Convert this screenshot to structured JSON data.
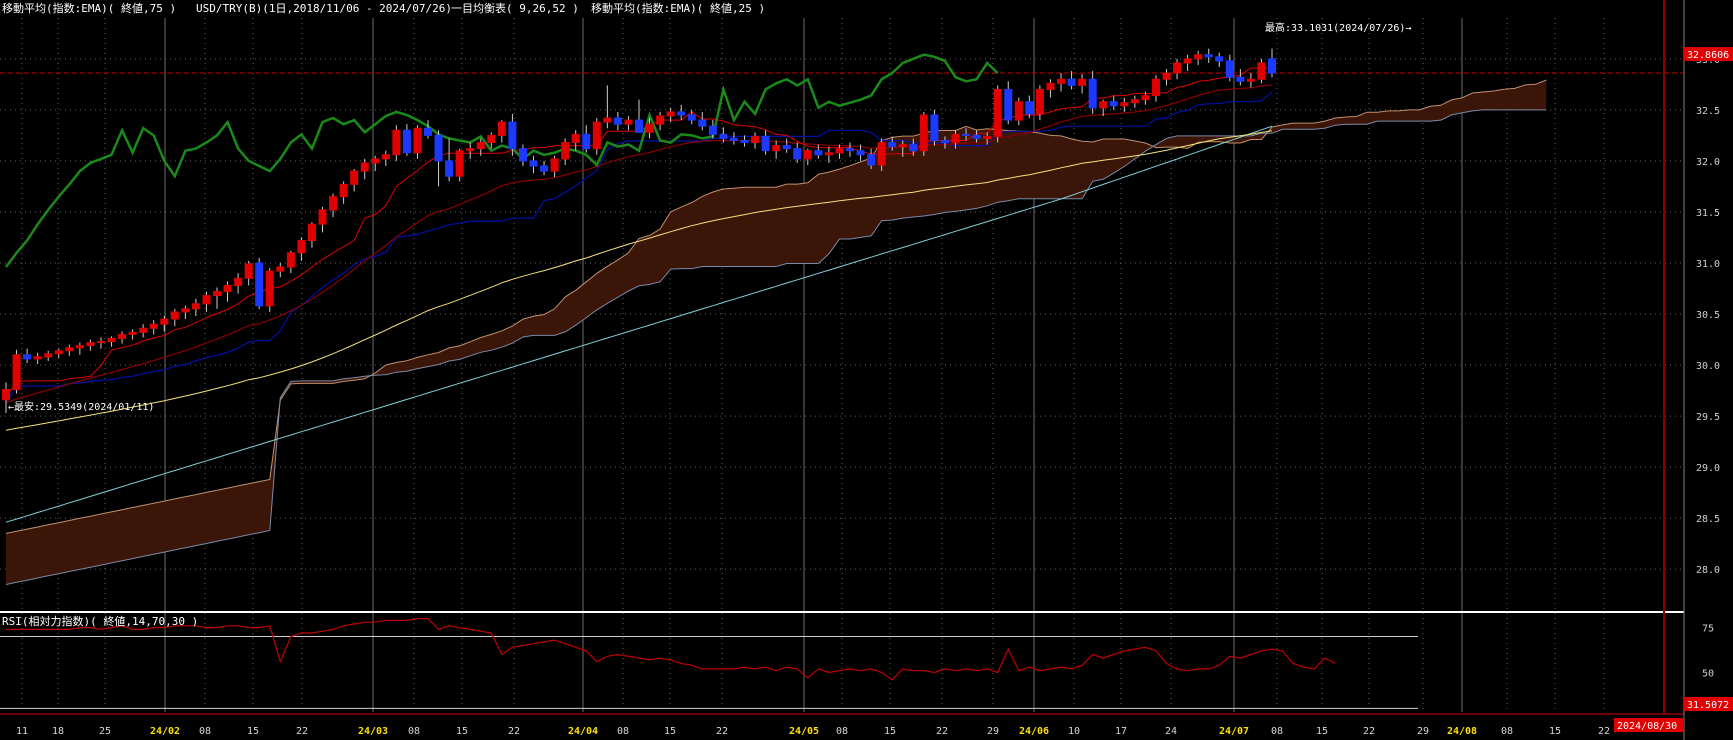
{
  "header": {
    "ema75_label": "移動平均(指数:EMA)( 終値,75 )",
    "symbol_label": "USD/TRY(B)(1日,2018/11/06 - 2024/07/26)",
    "ichimoku_label": "一目均衡表( 9,26,52 )",
    "ema25_label": "移動平均(指数:EMA)( 終値,25 )"
  },
  "annotations": {
    "high": "最高:33.1031(2024/07/26)→",
    "low": "←最安:29.5349(2024/01/11)"
  },
  "price_tag": "32.8606",
  "rsi_header": "RSI(相対力指数)( 終値,14,70,30 )",
  "rsi_tag": "31.5072",
  "date_tag": "2024/08/30",
  "colors": {
    "up_candle": "#e00000",
    "down_candle": "#1c39ff",
    "ema75": "#f4e27a",
    "ema25": "#8a0000",
    "tenkan": "#e00000",
    "kijun": "#0011aa",
    "chikou": "#1a8a1a",
    "senkou_b": "#c09070",
    "senkou_a": "#7a8aa8",
    "cloud": "#3a1508",
    "long_ma": "#7fd0d8",
    "rsi_line": "#c00000",
    "grid": "#606060",
    "month_line": "#999999",
    "cursor_line": "#8a0000",
    "yellow_tick": "#ffe000"
  },
  "chart_data": {
    "type": "candlestick",
    "title": "USD/TRY(B)(1日,2018/11/06 - 2024/07/26)",
    "ylim": [
      27.6,
      33.4
    ],
    "y_ticks": [
      "33.0",
      "32.5",
      "32.0",
      "31.5",
      "31.0",
      "30.5",
      "30.0",
      "29.5",
      "29.0",
      "28.5",
      "28.0"
    ],
    "x_ticks": [
      "11",
      "18",
      "25",
      "24/02",
      "08",
      "15",
      "22",
      "24/03",
      "08",
      "15",
      "22",
      "24/04",
      "08",
      "15",
      "22",
      "24/05",
      "08",
      "15",
      "22",
      "29",
      "24/06",
      "10",
      "17",
      "24",
      "24/07",
      "08",
      "15",
      "22",
      "29",
      "24/08",
      "08",
      "15",
      "22"
    ],
    "month_ticks": [
      "24/02",
      "24/03",
      "24/04",
      "24/05",
      "24/06",
      "24/07",
      "24/08"
    ],
    "last_close": 32.8606,
    "high": 33.1031,
    "high_date": "2024/07/26",
    "low": 29.5349,
    "low_date": "2024/01/11",
    "candles": [
      {
        "o": 29.66,
        "h": 29.83,
        "l": 29.53,
        "c": 29.76
      },
      {
        "o": 29.76,
        "h": 30.15,
        "l": 29.72,
        "c": 30.1
      },
      {
        "o": 30.1,
        "h": 30.16,
        "l": 30.02,
        "c": 30.06
      },
      {
        "o": 30.06,
        "h": 30.12,
        "l": 30.01,
        "c": 30.08
      },
      {
        "o": 30.08,
        "h": 30.14,
        "l": 30.04,
        "c": 30.11
      },
      {
        "o": 30.11,
        "h": 30.16,
        "l": 30.07,
        "c": 30.14
      },
      {
        "o": 30.14,
        "h": 30.2,
        "l": 30.09,
        "c": 30.17
      },
      {
        "o": 30.17,
        "h": 30.22,
        "l": 30.1,
        "c": 30.19
      },
      {
        "o": 30.19,
        "h": 30.25,
        "l": 30.14,
        "c": 30.22
      },
      {
        "o": 30.22,
        "h": 30.27,
        "l": 30.16,
        "c": 30.23
      },
      {
        "o": 30.23,
        "h": 30.28,
        "l": 30.18,
        "c": 30.26
      },
      {
        "o": 30.26,
        "h": 30.33,
        "l": 30.21,
        "c": 30.3
      },
      {
        "o": 30.3,
        "h": 30.35,
        "l": 30.25,
        "c": 30.32
      },
      {
        "o": 30.32,
        "h": 30.4,
        "l": 30.27,
        "c": 30.36
      },
      {
        "o": 30.36,
        "h": 30.44,
        "l": 30.3,
        "c": 30.4
      },
      {
        "o": 30.4,
        "h": 30.48,
        "l": 30.33,
        "c": 30.45
      },
      {
        "o": 30.45,
        "h": 30.55,
        "l": 30.38,
        "c": 30.52
      },
      {
        "o": 30.52,
        "h": 30.58,
        "l": 30.45,
        "c": 30.55
      },
      {
        "o": 30.55,
        "h": 30.65,
        "l": 30.48,
        "c": 30.6
      },
      {
        "o": 30.6,
        "h": 30.72,
        "l": 30.52,
        "c": 30.68
      },
      {
        "o": 30.68,
        "h": 30.76,
        "l": 30.55,
        "c": 30.72
      },
      {
        "o": 30.72,
        "h": 30.82,
        "l": 30.62,
        "c": 30.78
      },
      {
        "o": 30.78,
        "h": 30.9,
        "l": 30.7,
        "c": 30.85
      },
      {
        "o": 30.85,
        "h": 31.02,
        "l": 30.78,
        "c": 30.99
      },
      {
        "o": 31.0,
        "h": 31.05,
        "l": 30.55,
        "c": 30.58
      },
      {
        "o": 30.58,
        "h": 30.95,
        "l": 30.52,
        "c": 30.92
      },
      {
        "o": 30.92,
        "h": 31.0,
        "l": 30.86,
        "c": 30.96
      },
      {
        "o": 30.96,
        "h": 31.12,
        "l": 30.9,
        "c": 31.1
      },
      {
        "o": 31.1,
        "h": 31.25,
        "l": 31.02,
        "c": 31.22
      },
      {
        "o": 31.22,
        "h": 31.4,
        "l": 31.15,
        "c": 31.38
      },
      {
        "o": 31.38,
        "h": 31.55,
        "l": 31.3,
        "c": 31.52
      },
      {
        "o": 31.52,
        "h": 31.68,
        "l": 31.45,
        "c": 31.65
      },
      {
        "o": 31.65,
        "h": 31.8,
        "l": 31.58,
        "c": 31.77
      },
      {
        "o": 31.77,
        "h": 31.92,
        "l": 31.7,
        "c": 31.9
      },
      {
        "o": 31.9,
        "h": 32.02,
        "l": 31.82,
        "c": 31.98
      },
      {
        "o": 31.98,
        "h": 32.05,
        "l": 31.9,
        "c": 32.02
      },
      {
        "o": 32.02,
        "h": 32.1,
        "l": 31.95,
        "c": 32.06
      },
      {
        "o": 32.06,
        "h": 32.35,
        "l": 32.0,
        "c": 32.3
      },
      {
        "o": 32.3,
        "h": 32.36,
        "l": 32.05,
        "c": 32.08
      },
      {
        "o": 32.08,
        "h": 32.35,
        "l": 32.02,
        "c": 32.32
      },
      {
        "o": 32.32,
        "h": 32.4,
        "l": 32.22,
        "c": 32.25
      },
      {
        "o": 32.25,
        "h": 32.3,
        "l": 31.75,
        "c": 32.0
      },
      {
        "o": 32.0,
        "h": 32.22,
        "l": 31.8,
        "c": 31.85
      },
      {
        "o": 31.85,
        "h": 32.12,
        "l": 31.8,
        "c": 32.1
      },
      {
        "o": 32.1,
        "h": 32.18,
        "l": 32.02,
        "c": 32.12
      },
      {
        "o": 32.12,
        "h": 32.22,
        "l": 32.05,
        "c": 32.18
      },
      {
        "o": 32.18,
        "h": 32.28,
        "l": 32.12,
        "c": 32.25
      },
      {
        "o": 32.25,
        "h": 32.4,
        "l": 32.18,
        "c": 32.38
      },
      {
        "o": 32.38,
        "h": 32.46,
        "l": 32.05,
        "c": 32.12
      },
      {
        "o": 32.12,
        "h": 32.16,
        "l": 31.95,
        "c": 32.0
      },
      {
        "o": 32.0,
        "h": 32.05,
        "l": 31.88,
        "c": 31.95
      },
      {
        "o": 31.95,
        "h": 32.0,
        "l": 31.86,
        "c": 31.9
      },
      {
        "o": 31.9,
        "h": 32.05,
        "l": 31.84,
        "c": 32.02
      },
      {
        "o": 32.02,
        "h": 32.22,
        "l": 31.96,
        "c": 32.18
      },
      {
        "o": 32.18,
        "h": 32.3,
        "l": 32.1,
        "c": 32.26
      },
      {
        "o": 32.26,
        "h": 32.35,
        "l": 32.08,
        "c": 32.12
      },
      {
        "o": 32.12,
        "h": 32.42,
        "l": 32.06,
        "c": 32.38
      },
      {
        "o": 32.38,
        "h": 32.74,
        "l": 32.32,
        "c": 32.42
      },
      {
        "o": 32.42,
        "h": 32.48,
        "l": 32.3,
        "c": 32.36
      },
      {
        "o": 32.36,
        "h": 32.44,
        "l": 32.3,
        "c": 32.4
      },
      {
        "o": 32.4,
        "h": 32.6,
        "l": 32.35,
        "c": 32.28
      },
      {
        "o": 32.28,
        "h": 32.42,
        "l": 32.22,
        "c": 32.36
      },
      {
        "o": 32.36,
        "h": 32.48,
        "l": 32.3,
        "c": 32.44
      },
      {
        "o": 32.44,
        "h": 32.52,
        "l": 32.38,
        "c": 32.48
      },
      {
        "o": 32.48,
        "h": 32.55,
        "l": 32.4,
        "c": 32.45
      },
      {
        "o": 32.45,
        "h": 32.5,
        "l": 32.36,
        "c": 32.4
      },
      {
        "o": 32.4,
        "h": 32.48,
        "l": 32.3,
        "c": 32.34
      },
      {
        "o": 32.34,
        "h": 32.4,
        "l": 32.22,
        "c": 32.26
      },
      {
        "o": 32.26,
        "h": 32.33,
        "l": 32.18,
        "c": 32.22
      },
      {
        "o": 32.22,
        "h": 32.28,
        "l": 32.16,
        "c": 32.2
      },
      {
        "o": 32.2,
        "h": 32.25,
        "l": 32.14,
        "c": 32.18
      },
      {
        "o": 32.18,
        "h": 32.28,
        "l": 32.12,
        "c": 32.24
      },
      {
        "o": 32.24,
        "h": 32.3,
        "l": 32.06,
        "c": 32.1
      },
      {
        "o": 32.1,
        "h": 32.2,
        "l": 32.02,
        "c": 32.15
      },
      {
        "o": 32.15,
        "h": 32.22,
        "l": 32.08,
        "c": 32.12
      },
      {
        "o": 32.12,
        "h": 32.18,
        "l": 31.98,
        "c": 32.02
      },
      {
        "o": 32.02,
        "h": 32.12,
        "l": 31.96,
        "c": 32.1
      },
      {
        "o": 32.1,
        "h": 32.16,
        "l": 32.02,
        "c": 32.06
      },
      {
        "o": 32.06,
        "h": 32.14,
        "l": 31.98,
        "c": 32.08
      },
      {
        "o": 32.08,
        "h": 32.16,
        "l": 32.02,
        "c": 32.12
      },
      {
        "o": 32.12,
        "h": 32.18,
        "l": 32.04,
        "c": 32.1
      },
      {
        "o": 32.1,
        "h": 32.16,
        "l": 32.0,
        "c": 32.06
      },
      {
        "o": 32.06,
        "h": 32.12,
        "l": 31.92,
        "c": 31.96
      },
      {
        "o": 31.96,
        "h": 32.22,
        "l": 31.9,
        "c": 32.18
      },
      {
        "o": 32.18,
        "h": 32.24,
        "l": 32.1,
        "c": 32.14
      },
      {
        "o": 32.14,
        "h": 32.2,
        "l": 32.04,
        "c": 32.16
      },
      {
        "o": 32.16,
        "h": 32.22,
        "l": 32.05,
        "c": 32.1
      },
      {
        "o": 32.1,
        "h": 32.48,
        "l": 32.05,
        "c": 32.45
      },
      {
        "o": 32.45,
        "h": 32.5,
        "l": 32.15,
        "c": 32.2
      },
      {
        "o": 32.2,
        "h": 32.24,
        "l": 32.12,
        "c": 32.18
      },
      {
        "o": 32.18,
        "h": 32.3,
        "l": 32.12,
        "c": 32.26
      },
      {
        "o": 32.26,
        "h": 32.32,
        "l": 32.2,
        "c": 32.25
      },
      {
        "o": 32.25,
        "h": 32.3,
        "l": 32.18,
        "c": 32.22
      },
      {
        "o": 32.22,
        "h": 32.28,
        "l": 32.16,
        "c": 32.24
      },
      {
        "o": 32.24,
        "h": 32.74,
        "l": 32.18,
        "c": 32.7
      },
      {
        "o": 32.7,
        "h": 32.78,
        "l": 32.36,
        "c": 32.4
      },
      {
        "o": 32.4,
        "h": 32.62,
        "l": 32.35,
        "c": 32.58
      },
      {
        "o": 32.58,
        "h": 32.64,
        "l": 32.42,
        "c": 32.46
      },
      {
        "o": 32.46,
        "h": 32.74,
        "l": 32.4,
        "c": 32.7
      },
      {
        "o": 32.7,
        "h": 32.8,
        "l": 32.62,
        "c": 32.76
      },
      {
        "o": 32.76,
        "h": 32.86,
        "l": 32.68,
        "c": 32.8
      },
      {
        "o": 32.8,
        "h": 32.88,
        "l": 32.7,
        "c": 32.74
      },
      {
        "o": 32.74,
        "h": 32.85,
        "l": 32.66,
        "c": 32.8
      },
      {
        "o": 32.8,
        "h": 32.88,
        "l": 32.46,
        "c": 32.52
      },
      {
        "o": 32.52,
        "h": 32.6,
        "l": 32.44,
        "c": 32.58
      },
      {
        "o": 32.58,
        "h": 32.64,
        "l": 32.5,
        "c": 32.54
      },
      {
        "o": 32.54,
        "h": 32.62,
        "l": 32.48,
        "c": 32.57
      },
      {
        "o": 32.57,
        "h": 32.64,
        "l": 32.52,
        "c": 32.6
      },
      {
        "o": 32.6,
        "h": 32.68,
        "l": 32.55,
        "c": 32.64
      },
      {
        "o": 32.64,
        "h": 32.84,
        "l": 32.58,
        "c": 32.8
      },
      {
        "o": 32.8,
        "h": 32.9,
        "l": 32.74,
        "c": 32.86
      },
      {
        "o": 32.86,
        "h": 33.0,
        "l": 32.8,
        "c": 32.96
      },
      {
        "o": 32.96,
        "h": 33.04,
        "l": 32.88,
        "c": 33.0
      },
      {
        "o": 33.0,
        "h": 33.08,
        "l": 32.94,
        "c": 33.04
      },
      {
        "o": 33.04,
        "h": 33.1,
        "l": 32.96,
        "c": 33.02
      },
      {
        "o": 33.02,
        "h": 33.06,
        "l": 32.92,
        "c": 32.98
      },
      {
        "o": 32.98,
        "h": 33.04,
        "l": 32.78,
        "c": 32.82
      },
      {
        "o": 32.82,
        "h": 32.9,
        "l": 32.74,
        "c": 32.78
      },
      {
        "o": 32.78,
        "h": 32.86,
        "l": 32.72,
        "c": 32.8
      },
      {
        "o": 32.8,
        "h": 33.0,
        "l": 32.76,
        "c": 32.96
      },
      {
        "o": 33.0,
        "h": 33.1,
        "l": 32.82,
        "c": 32.86
      }
    ],
    "rsi": {
      "ylim": [
        28,
        82
      ],
      "y_ticks": [
        "75",
        "50"
      ],
      "levels": [
        70,
        30
      ],
      "values": [
        74,
        74,
        74,
        74,
        74,
        74,
        74,
        75,
        75,
        74,
        75,
        76,
        74,
        74,
        75,
        75,
        76,
        76,
        76,
        75,
        75,
        76,
        76,
        75,
        75,
        76,
        56,
        70,
        72,
        72,
        73,
        74,
        76,
        77,
        78,
        78,
        79,
        79,
        79,
        80,
        80,
        74,
        76,
        75,
        74,
        73,
        72,
        60,
        64,
        65,
        66,
        67,
        68,
        66,
        64,
        62,
        56,
        59,
        60,
        59,
        58,
        57,
        58,
        57,
        55,
        54,
        52,
        52,
        52,
        52,
        53,
        52,
        53,
        51,
        53,
        52,
        47,
        52,
        50,
        51,
        52,
        51,
        52,
        50,
        46,
        52,
        51,
        51,
        50,
        52,
        51,
        52,
        51,
        52,
        50,
        63,
        51,
        53,
        51,
        52,
        53,
        52,
        54,
        60,
        58,
        60,
        62,
        63,
        64,
        62,
        55,
        52,
        51,
        52,
        52,
        54,
        59,
        58,
        60,
        62,
        63,
        62,
        55,
        53,
        52,
        58,
        55
      ],
      "title": "RSI(相対力指数)( 終値,14,70,30 )"
    }
  }
}
